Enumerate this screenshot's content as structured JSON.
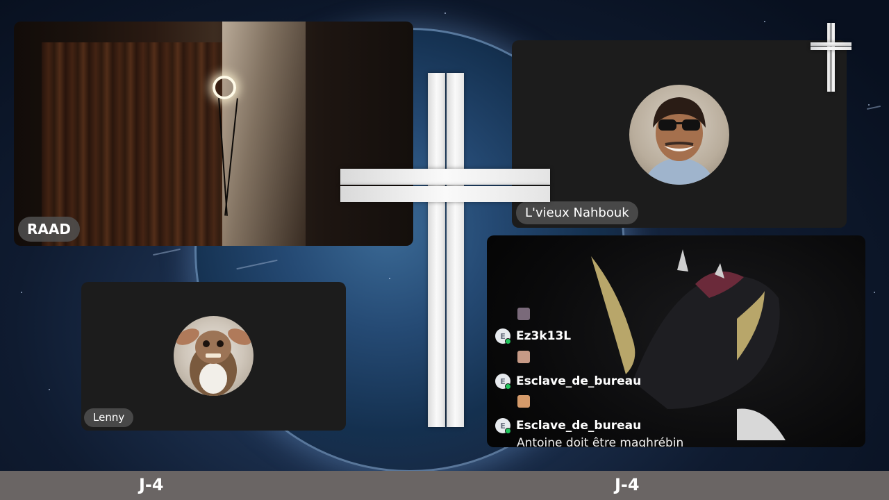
{
  "participants": {
    "raad": {
      "name": "RAAD"
    },
    "lenny": {
      "name": "Lenny"
    },
    "nahbouk": {
      "name": "L'vieux Nahbouk"
    }
  },
  "chat": {
    "messages": [
      {
        "badge": "E",
        "user": "Ez3k13L",
        "text": ""
      },
      {
        "badge": "E",
        "user": "Esclave_de_bureau",
        "text": ""
      },
      {
        "badge": "E",
        "user": "Esclave_de_bureau",
        "text": "Antoine doit être maghrébin"
      }
    ]
  },
  "bottom_bar": {
    "left_label": "J-4",
    "right_label": "J-4"
  },
  "colors": {
    "tile_bg": "#1c1c1c",
    "pill_bg": "#505050",
    "bar_bg": "#6a6564",
    "online": "#22c55e"
  }
}
